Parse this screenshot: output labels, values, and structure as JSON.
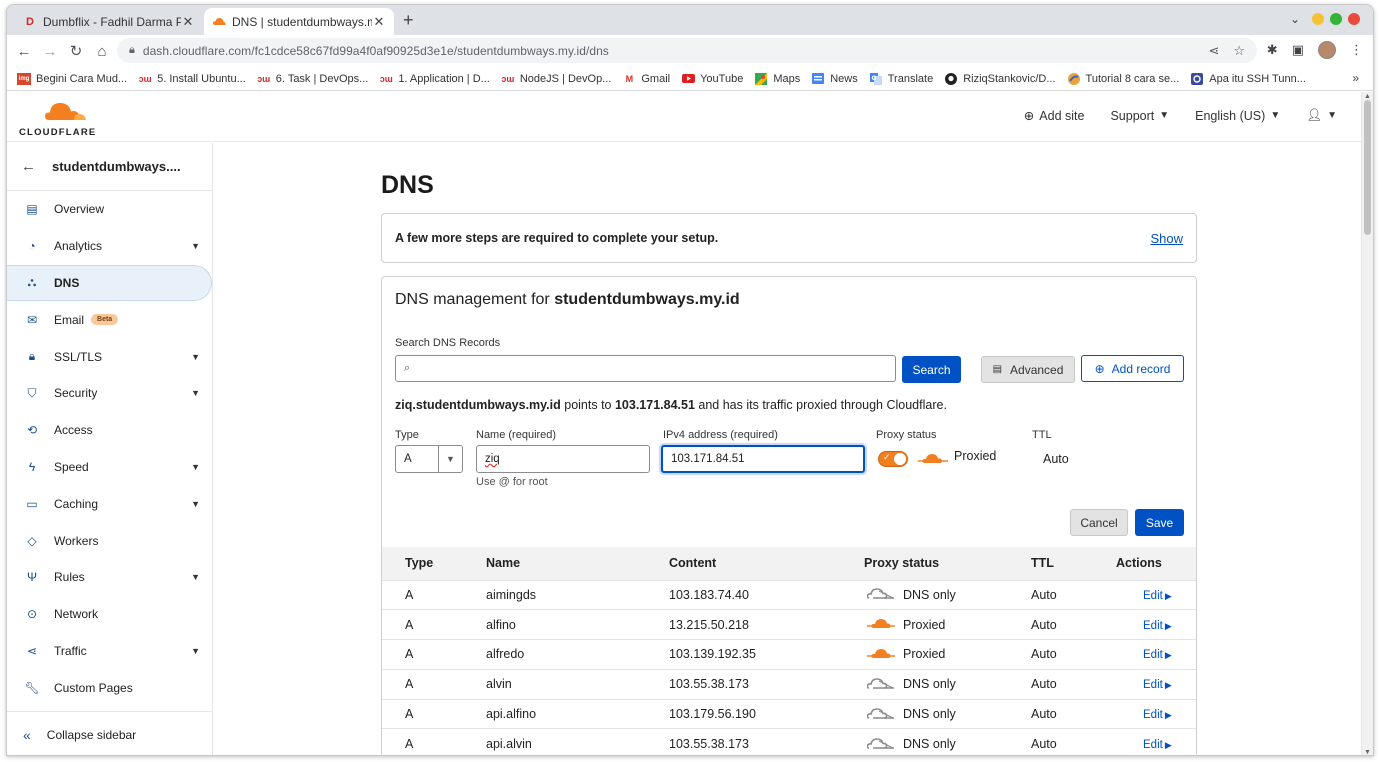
{
  "browser": {
    "tabs": [
      {
        "title": "Dumbflix - Fadhil Darma Pute",
        "icon": "dumbways-icon",
        "active": false
      },
      {
        "title": "DNS | studentdumbways.my.id",
        "icon": "cloudflare-icon",
        "active": true
      }
    ],
    "new_tab": "+",
    "tab_search": "⌄",
    "url": "dash.cloudflare.com/fc1cdce58c67fd99a4f0af90925d3e1e/studentdumbways.my.id/dns",
    "bookmarks": [
      {
        "label": "Begini Cara Mud...",
        "icon": "image-icon"
      },
      {
        "label": "5. Install Ubuntu...",
        "icon": "dumbways-icon"
      },
      {
        "label": "6. Task | DevOps...",
        "icon": "dumbways-icon"
      },
      {
        "label": "1. Application | D...",
        "icon": "dumbways-icon"
      },
      {
        "label": "NodeJS | DevOp...",
        "icon": "dumbways-icon"
      },
      {
        "label": "Gmail",
        "icon": "gmail-icon"
      },
      {
        "label": "YouTube",
        "icon": "youtube-icon"
      },
      {
        "label": "Maps",
        "icon": "maps-icon"
      },
      {
        "label": "News",
        "icon": "news-icon"
      },
      {
        "label": "Translate",
        "icon": "translate-icon"
      },
      {
        "label": "RiziqStankovic/D...",
        "icon": "github-icon"
      },
      {
        "label": "Tutorial 8 cara se...",
        "icon": "site-icon"
      },
      {
        "label": "Apa itu SSH Tunn...",
        "icon": "site-icon"
      }
    ],
    "more": "»"
  },
  "header": {
    "logo_text": "CLOUDFLARE",
    "add_site": "Add site",
    "support": "Support",
    "language": "English (US)"
  },
  "sidebar": {
    "zone": "studentdumbways....",
    "items": [
      {
        "label": "Overview",
        "icon": "document-icon",
        "dropdown": false
      },
      {
        "label": "Analytics",
        "icon": "clock-chart-icon",
        "dropdown": true
      },
      {
        "label": "DNS",
        "icon": "network-tree-icon",
        "dropdown": false,
        "active": true
      },
      {
        "label": "Email",
        "icon": "envelope-icon",
        "dropdown": false,
        "badge": "Beta"
      },
      {
        "label": "SSL/TLS",
        "icon": "lock-icon",
        "dropdown": true
      },
      {
        "label": "Security",
        "icon": "shield-icon",
        "dropdown": true
      },
      {
        "label": "Access",
        "icon": "access-icon",
        "dropdown": false
      },
      {
        "label": "Speed",
        "icon": "lightning-icon",
        "dropdown": true
      },
      {
        "label": "Caching",
        "icon": "server-icon",
        "dropdown": true
      },
      {
        "label": "Workers",
        "icon": "workers-icon",
        "dropdown": false
      },
      {
        "label": "Rules",
        "icon": "rules-icon",
        "dropdown": true
      },
      {
        "label": "Network",
        "icon": "location-pin-icon",
        "dropdown": false
      },
      {
        "label": "Traffic",
        "icon": "traffic-icon",
        "dropdown": true
      },
      {
        "label": "Custom Pages",
        "icon": "wrench-icon",
        "dropdown": false
      }
    ],
    "collapse": "Collapse sidebar"
  },
  "main": {
    "title": "DNS",
    "setup_notice": "A few more steps are required to complete your setup.",
    "show_link": "Show",
    "mgmt_prefix": "DNS management for ",
    "mgmt_domain": "studentdumbways.my.id",
    "search_label": "Search DNS Records",
    "search_placeholder": "",
    "search_button": "Search",
    "advanced_button": "Advanced",
    "add_record_button": "Add record",
    "points_name": "ziq.studentdumbways.my.id",
    "points_mid": " points to ",
    "points_ip": "103.171.84.51",
    "points_tail": " and has its traffic proxied through Cloudflare.",
    "form": {
      "type_label": "Type",
      "type_value": "A",
      "name_label": "Name (required)",
      "name_value": "ziq",
      "name_hint": "Use @ for root",
      "ip_label": "IPv4 address (required)",
      "ip_value": "103.171.84.51",
      "proxy_label": "Proxy status",
      "proxy_value": "Proxied",
      "ttl_label": "TTL",
      "ttl_value": "Auto",
      "cancel": "Cancel",
      "save": "Save"
    },
    "table": {
      "headers": [
        "Type",
        "Name",
        "Content",
        "Proxy status",
        "TTL",
        "Actions"
      ],
      "edit_label": "Edit",
      "rows": [
        {
          "type": "A",
          "name": "aimingds",
          "content": "103.183.74.40",
          "proxy": "DNS only",
          "ttl": "Auto"
        },
        {
          "type": "A",
          "name": "alfino",
          "content": "13.215.50.218",
          "proxy": "Proxied",
          "ttl": "Auto"
        },
        {
          "type": "A",
          "name": "alfredo",
          "content": "103.139.192.35",
          "proxy": "Proxied",
          "ttl": "Auto"
        },
        {
          "type": "A",
          "name": "alvin",
          "content": "103.55.38.173",
          "proxy": "DNS only",
          "ttl": "Auto"
        },
        {
          "type": "A",
          "name": "api.alfino",
          "content": "103.179.56.190",
          "proxy": "DNS only",
          "ttl": "Auto"
        },
        {
          "type": "A",
          "name": "api.alvin",
          "content": "103.55.38.173",
          "proxy": "DNS only",
          "ttl": "Auto"
        }
      ]
    }
  },
  "colors": {
    "accent": "#0051c3",
    "cloudflare_orange": "#f38020",
    "grey_cloud": "#8c8c8c"
  }
}
